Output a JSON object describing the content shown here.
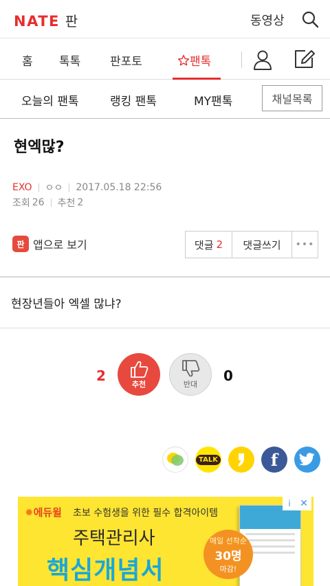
{
  "header": {
    "logo_text": "NATE",
    "logo_sub": "판",
    "video_link": "동영상",
    "search_icon": "search-icon"
  },
  "nav": {
    "items": [
      {
        "label": "홈"
      },
      {
        "label": "톡톡"
      },
      {
        "label": "판포토"
      },
      {
        "label": "팬톡",
        "active": true
      }
    ],
    "active_color": "#e62e2e",
    "user_icon": "user-icon",
    "write_icon": "write-icon"
  },
  "subnav": {
    "items": [
      {
        "label": "오늘의 팬톡"
      },
      {
        "label": "랭킹 팬톡"
      },
      {
        "label": "MY팬톡"
      }
    ],
    "channel_button": "채널목록"
  },
  "post": {
    "title": "현엑많?",
    "category": "EXO",
    "author": "ㅇㅇ",
    "datetime": "2017.05.18 22:56",
    "views_label": "조회",
    "views": "26",
    "recommend_label": "추천",
    "recommend": "2",
    "body": "현장년들아 엑셀 많냐?"
  },
  "actions": {
    "app_view_icon": "판",
    "app_view_label": "앱으로 보기",
    "comment_label": "댓글",
    "comment_count": "2",
    "write_comment_label": "댓글쓰기",
    "more_label": "•••"
  },
  "votes": {
    "up_count": "2",
    "up_label": "추천",
    "down_count": "0",
    "down_label": "반대"
  },
  "share": {
    "kakaotalk_icon": "kakaotalk-icon",
    "talk_text": "TALK",
    "kakaostory_icon": "kakaostory-icon",
    "facebook_text": "f",
    "twitter_icon": "twitter-icon"
  },
  "ad": {
    "brand": "에듀윌",
    "brand_sun": "✹",
    "tagline": "초보 수험생을 위한 필수 합격아이템",
    "title_line1": "주택관리사",
    "title_line2": "핵심개념서",
    "badge_top": "매일 선착순",
    "badge_mid": "30명",
    "badge_bot": "마감!",
    "info": "i",
    "close": "✕"
  },
  "colors": {
    "accent": "#e62e2e",
    "ad_background": "#fde531",
    "facebook": "#3b5998",
    "twitter": "#3a9be5"
  }
}
